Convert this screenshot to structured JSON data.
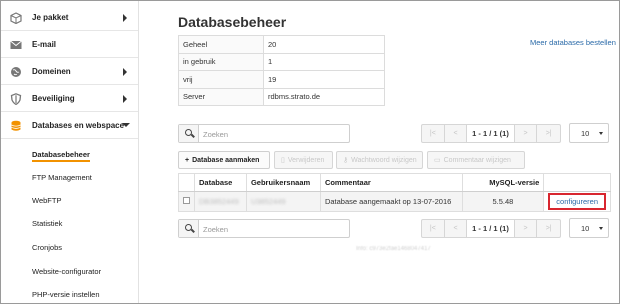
{
  "sidebar": {
    "items": [
      {
        "label": "Je pakket",
        "icon": "package-icon",
        "expandable": true
      },
      {
        "label": "E-mail",
        "icon": "mail-icon",
        "expandable": false
      },
      {
        "label": "Domeinen",
        "icon": "globe-icon",
        "expandable": true
      },
      {
        "label": "Beveiliging",
        "icon": "shield-icon",
        "expandable": true
      },
      {
        "label": "Databases en webspace",
        "icon": "database-icon",
        "expandable": true,
        "expanded": true
      }
    ],
    "subitems": [
      {
        "label": "Databasebeheer",
        "active": true
      },
      {
        "label": "FTP Management"
      },
      {
        "label": "WebFTP"
      },
      {
        "label": "Statistiek"
      },
      {
        "label": "Cronjobs"
      },
      {
        "label": "Website-configurator"
      },
      {
        "label": "PHP-versie instellen"
      }
    ],
    "active_color": "#f29200"
  },
  "main": {
    "title": "Databasebeheer",
    "more_link": "Meer databases bestellen",
    "summary": [
      {
        "label": "Geheel",
        "value": "20"
      },
      {
        "label": "in gebruik",
        "value": "1"
      },
      {
        "label": "vrij",
        "value": "19"
      },
      {
        "label": "Server",
        "value": "rdbms.strato.de"
      }
    ],
    "search": {
      "placeholder": "Zoeken"
    },
    "pager": {
      "first": "|<",
      "prev": "<",
      "info": "1 - 1 / 1 (1)",
      "next": ">",
      "last": ">|"
    },
    "per_page": "10",
    "toolbar": {
      "add": "Database aanmaken",
      "delete": "Verwijderen",
      "password": "Wachtwoord wijzigen",
      "comment": "Commentaar wijzigen"
    },
    "table": {
      "headers": [
        "Database",
        "Gebruikersnaam",
        "Commentaar",
        "MySQL-versie",
        ""
      ],
      "rows": [
        {
          "database": "DB3852449",
          "username": "U3852449",
          "comment": "Database aangemaakt op 13-07-2016",
          "mysql": "5.5.48",
          "action": "configureren"
        }
      ]
    },
    "footer_info": "Info: c973e2fae1468047417"
  },
  "colors": {
    "link": "#2a6aa8",
    "highlight_border": "#d8262f",
    "accent": "#f29200"
  }
}
